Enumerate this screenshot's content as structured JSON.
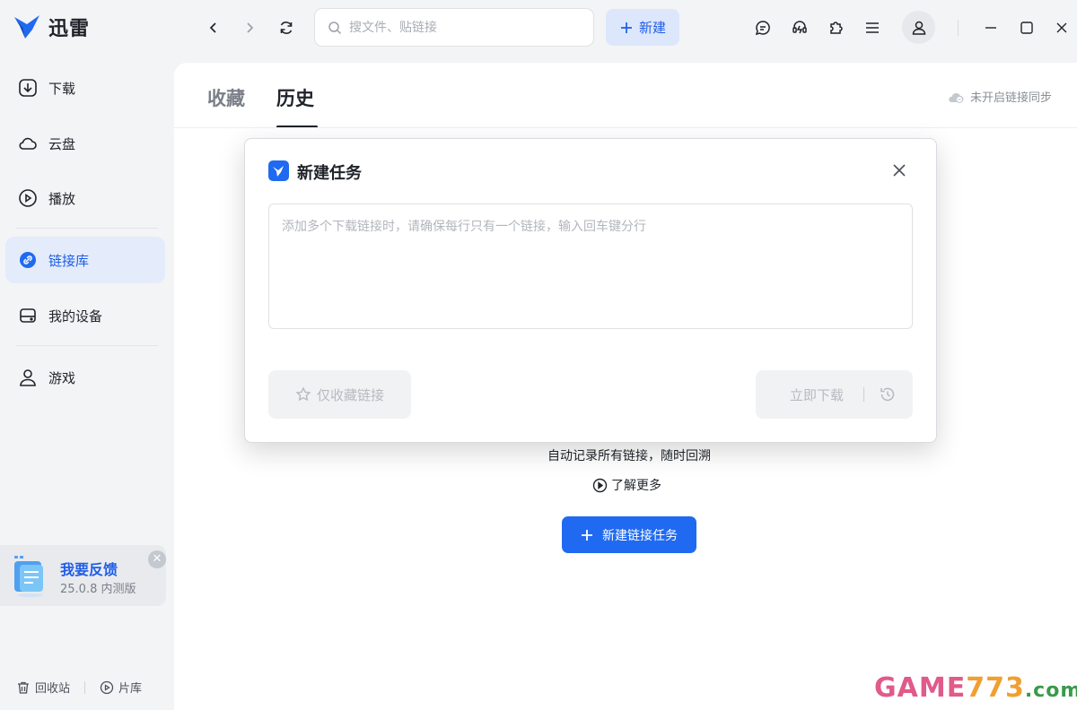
{
  "app": {
    "name": "迅雷"
  },
  "sidebar": {
    "items": [
      {
        "label": "下载",
        "icon": "download-icon"
      },
      {
        "label": "云盘",
        "icon": "cloud-icon"
      },
      {
        "label": "播放",
        "icon": "play-icon"
      },
      {
        "label": "链接库",
        "icon": "link-icon",
        "active": true
      },
      {
        "label": "我的设备",
        "icon": "device-icon"
      },
      {
        "label": "游戏",
        "icon": "user-icon"
      }
    ],
    "feedback": {
      "title": "我要反馈",
      "version": "25.0.8 内测版"
    },
    "bottom": {
      "recycle": "回收站",
      "library": "片库"
    }
  },
  "topbar": {
    "search_placeholder": "搜文件、贴链接",
    "new_label": "新建"
  },
  "main": {
    "tabs": [
      {
        "label": "收藏",
        "active": false
      },
      {
        "label": "历史",
        "active": true
      }
    ],
    "sync_status": "未开启链接同步",
    "empty_desc": "自动记录所有链接，随时回溯",
    "learn_more": "了解更多",
    "new_link_task": "新建链接任务"
  },
  "dialog": {
    "title": "新建任务",
    "textarea_placeholder": "添加多个下载链接时，请确保每行只有一个链接，输入回车键分行",
    "fav_only_label": "仅收藏链接",
    "download_now_label": "立即下载"
  },
  "watermark": {
    "part1": "GAME",
    "part2": "773",
    "part3": ".com"
  },
  "colors": {
    "accent": "#1f6af0",
    "active_bg": "#e4ecfb",
    "sidebar_bg": "#f3f4f6"
  }
}
